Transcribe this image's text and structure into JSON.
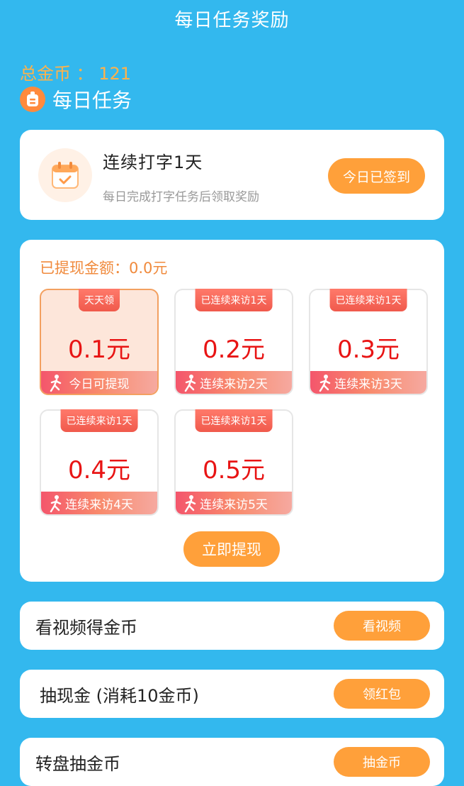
{
  "header": {
    "title": "每日任务奖励"
  },
  "summary": {
    "total_coins": "总金币 ： 121",
    "daily_task_label": "每日任务"
  },
  "signin": {
    "title": "连续打字1天",
    "subtitle": "每日完成打字任务后领取奖励",
    "button": "今日已签到"
  },
  "withdraw": {
    "withdrawn_label": "已提现金额：0.0元",
    "tiles": [
      {
        "tag": "天天领",
        "amount": "0.1元",
        "footer": "今日可提现"
      },
      {
        "tag": "已连续来访1天",
        "amount": "0.2元",
        "footer": "连续来访2天"
      },
      {
        "tag": "已连续来访1天",
        "amount": "0.3元",
        "footer": "连续来访3天"
      },
      {
        "tag": "已连续来访1天",
        "amount": "0.4元",
        "footer": "连续来访4天"
      },
      {
        "tag": "已连续来访1天",
        "amount": "0.5元",
        "footer": "连续来访5天"
      }
    ],
    "button": "立即提现"
  },
  "tasks": [
    {
      "label": "看视频得金币",
      "button": "看视频"
    },
    {
      "label": "抽现金 (消耗10金币)",
      "button": "领红包"
    },
    {
      "label": "转盘抽金币",
      "button": "抽金币"
    }
  ],
  "colors": {
    "background": "#33b8ee",
    "accent": "#ffa03a",
    "amount_red": "#e81414",
    "coins_orange": "#ffb24a"
  },
  "icons": [
    "daily-task-icon",
    "calendar-check-icon",
    "runner-icon"
  ]
}
